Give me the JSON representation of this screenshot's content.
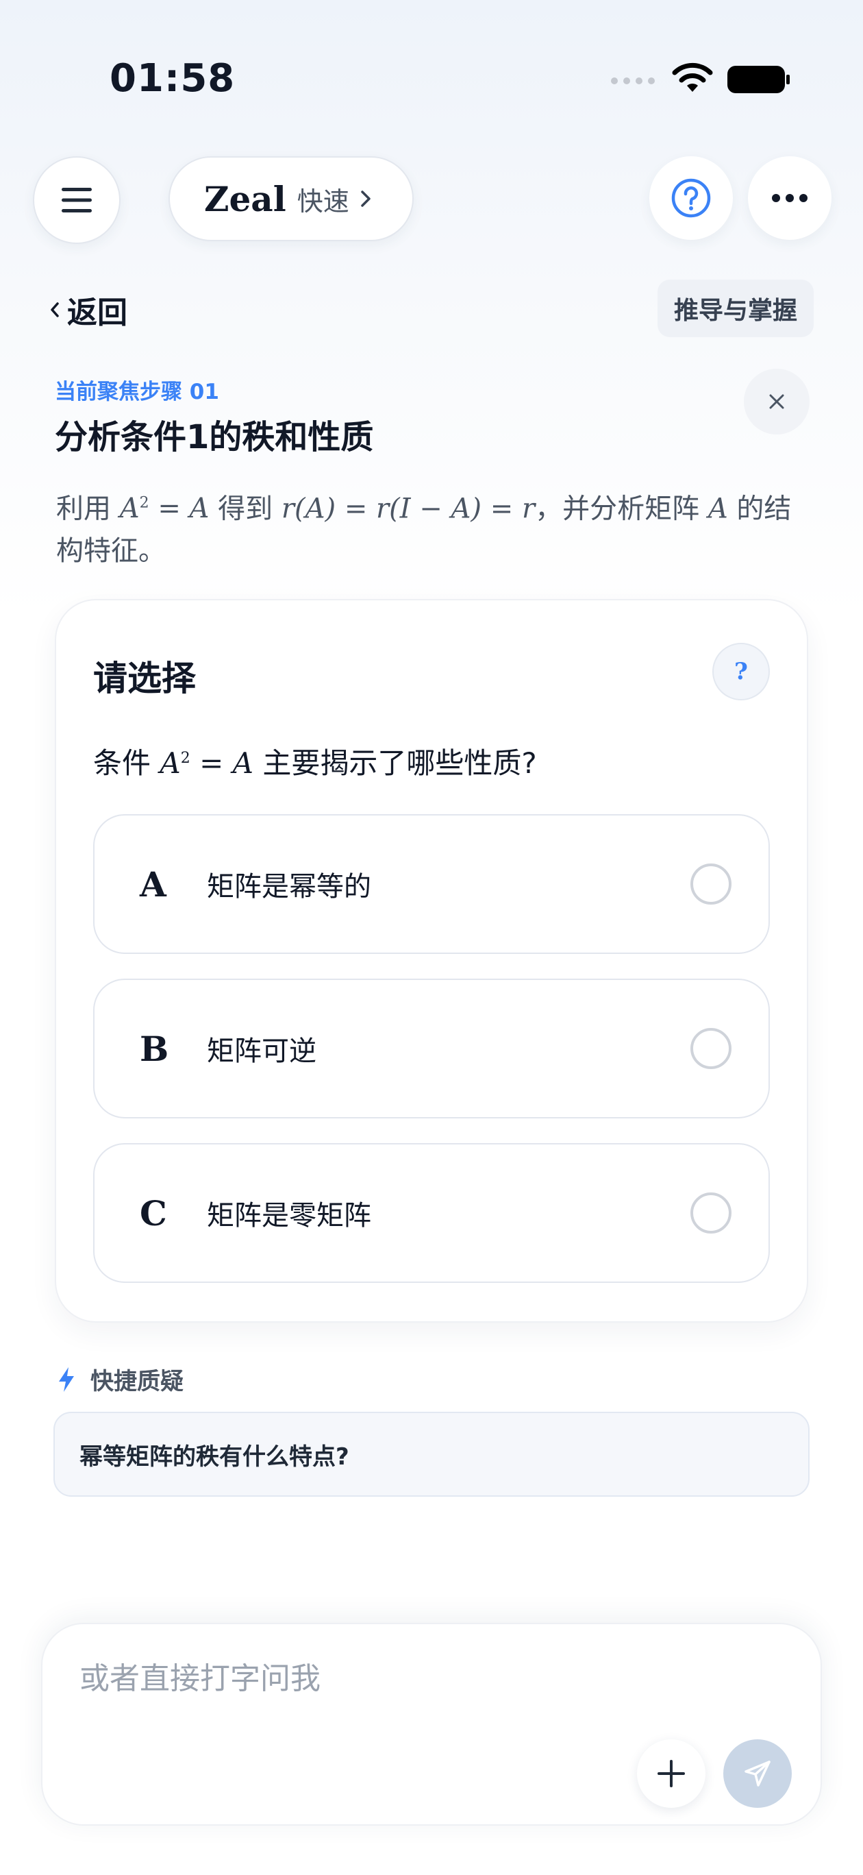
{
  "status_bar": {
    "time": "01:58"
  },
  "header": {
    "model_name": "Zeal",
    "model_mode": "快速"
  },
  "nav": {
    "back_label": "返回",
    "tag_label": "推导与掌握"
  },
  "step": {
    "label": "当前聚焦步骤 01",
    "title": "分析条件1的秩和性质",
    "desc_prefix": "利用",
    "desc_eq1_lhs": "A",
    "desc_eq1_sup": "2",
    "desc_eq1_rhs": " = A",
    "desc_mid": "得到",
    "desc_eq2": "r(A) = r(I − A) = r",
    "desc_tail": "，并分析矩阵",
    "desc_var": "A",
    "desc_end": "的结构特征。"
  },
  "card": {
    "title": "请选择",
    "help_symbol": "?",
    "question_prefix": "条件",
    "question_lhs": "A",
    "question_sup": "2",
    "question_rhs": " = A",
    "question_suffix": "主要揭示了哪些性质?",
    "options": [
      {
        "letter": "A",
        "text": "矩阵是幂等的",
        "selected": false
      },
      {
        "letter": "B",
        "text": "矩阵可逆",
        "selected": false
      },
      {
        "letter": "C",
        "text": "矩阵是零矩阵",
        "selected": false
      }
    ]
  },
  "quick": {
    "label": "快捷质疑",
    "items": [
      "幂等矩阵的秩有什么特点?"
    ]
  },
  "composer": {
    "placeholder": "或者直接打字问我"
  },
  "colors": {
    "accent": "#3b82f6",
    "text": "#111827",
    "muted": "#4b5563"
  }
}
